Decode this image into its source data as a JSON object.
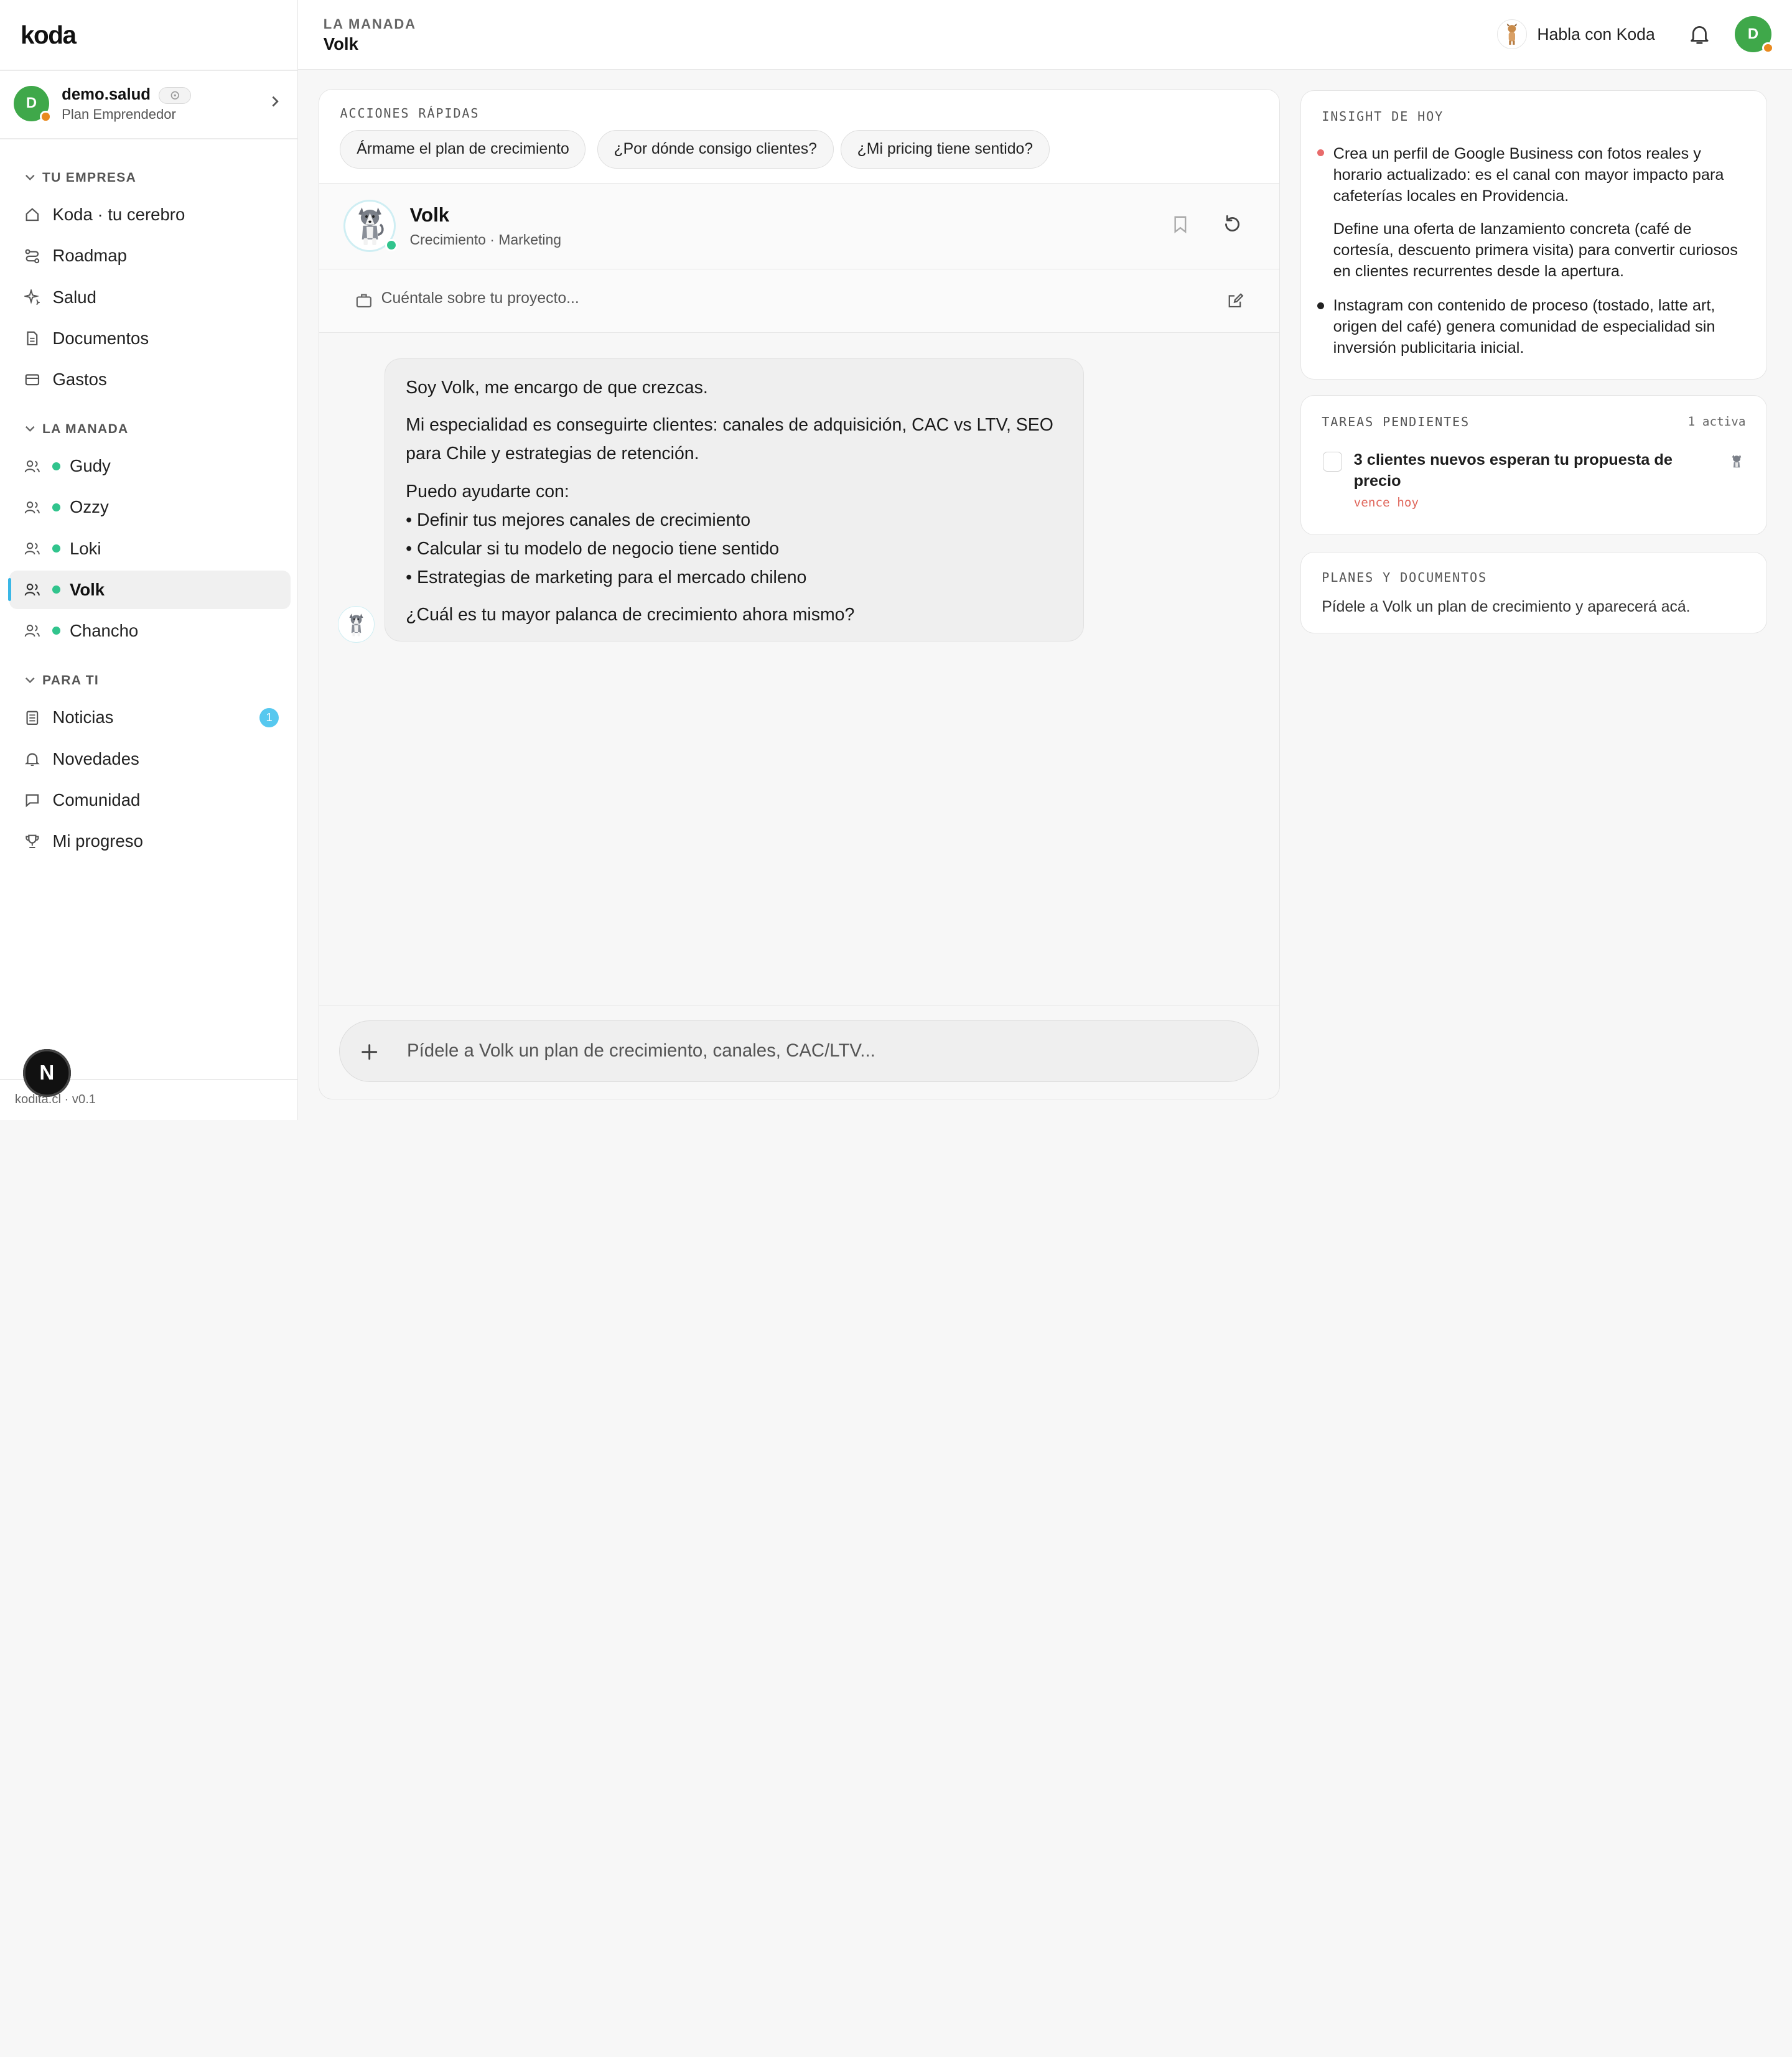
{
  "sidebar": {
    "logo": "koda",
    "account": {
      "initial": "D",
      "name": "demo.salud",
      "plan": "Plan Emprendedor"
    },
    "sections": [
      {
        "label": "TU EMPRESA",
        "items": [
          {
            "label": "Koda · tu cerebro",
            "icon": "home-icon"
          },
          {
            "label": "Roadmap",
            "icon": "roadmap-icon"
          },
          {
            "label": "Salud",
            "icon": "sparkle-icon"
          },
          {
            "label": "Documentos",
            "icon": "document-icon"
          },
          {
            "label": "Gastos",
            "icon": "wallet-icon"
          }
        ]
      },
      {
        "label": "LA MANADA",
        "items": [
          {
            "label": "Gudy",
            "icon": "users-icon"
          },
          {
            "label": "Ozzy",
            "icon": "users-icon"
          },
          {
            "label": "Loki",
            "icon": "users-icon"
          },
          {
            "label": "Volk",
            "icon": "users-icon",
            "active": true
          },
          {
            "label": "Chancho",
            "icon": "users-icon"
          }
        ]
      },
      {
        "label": "PARA TI",
        "items": [
          {
            "label": "Noticias",
            "icon": "newspaper-icon",
            "count": "1"
          },
          {
            "label": "Novedades",
            "icon": "bell-icon"
          },
          {
            "label": "Comunidad",
            "icon": "chat-icon"
          },
          {
            "label": "Mi progreso",
            "icon": "trophy-icon"
          }
        ]
      }
    ],
    "footer": "kodita.cl · v0.1",
    "dev_badge": "N"
  },
  "header": {
    "crumb": "LA MANADA",
    "title": "Volk",
    "talk_label": "Habla con Koda",
    "avatar_initial": "D"
  },
  "quick_actions": {
    "label": "ACCIONES RÁPIDAS",
    "chips": [
      "Ármame el plan de crecimiento",
      "¿Por dónde consigo clientes?",
      "¿Mi pricing tiene sentido?"
    ]
  },
  "agent": {
    "name": "Volk",
    "subtitle": "Crecimiento · Marketing",
    "project_prompt": "Cuéntale sobre tu proyecto..."
  },
  "message": {
    "intro": "Soy Volk, me encargo de que crezcas.",
    "specialty": "Mi especialidad es conseguirte clientes: canales de adquisición, CAC vs LTV, SEO para Chile y estrategias de retención.",
    "help_heading": "Puedo ayudarte con:",
    "help_items": [
      "• Definir tus mejores canales de crecimiento",
      "• Calcular si tu modelo de negocio tiene sentido",
      "• Estrategias de marketing para el mercado chileno"
    ],
    "question": "¿Cuál es tu mayor palanca de crecimiento ahora mismo?"
  },
  "composer": {
    "placeholder": "Pídele a Volk un plan de crecimiento, canales, CAC/LTV..."
  },
  "insight": {
    "label": "INSIGHT DE HOY",
    "items": [
      "Crea un perfil de Google Business con fotos reales y horario actualizado: es el canal con mayor impacto para cafeterías locales en Providencia.",
      "Define una oferta de lanzamiento concreta (café de cortesía, descuento primera visita) para convertir curiosos en clientes recurrentes desde la apertura.",
      "Instagram con contenido de proceso (tostado, latte art, origen del café) genera comunidad de especialidad sin inversión publicitaria inicial."
    ]
  },
  "tasks": {
    "label": "TAREAS PENDIENTES",
    "count": "1 activa",
    "items": [
      {
        "title": "3 clientes nuevos esperan tu propuesta de precio",
        "due": "vence hoy"
      }
    ]
  },
  "plans": {
    "label": "PLANES Y DOCUMENTOS",
    "empty": "Pídele a Volk un plan de crecimiento y aparecerá acá."
  },
  "colors": {
    "accent": "#3ab7e6",
    "online": "#31c48d",
    "avatar": "#3fa84a",
    "status_dot": "#e98a1f",
    "danger": "#e0675c"
  }
}
